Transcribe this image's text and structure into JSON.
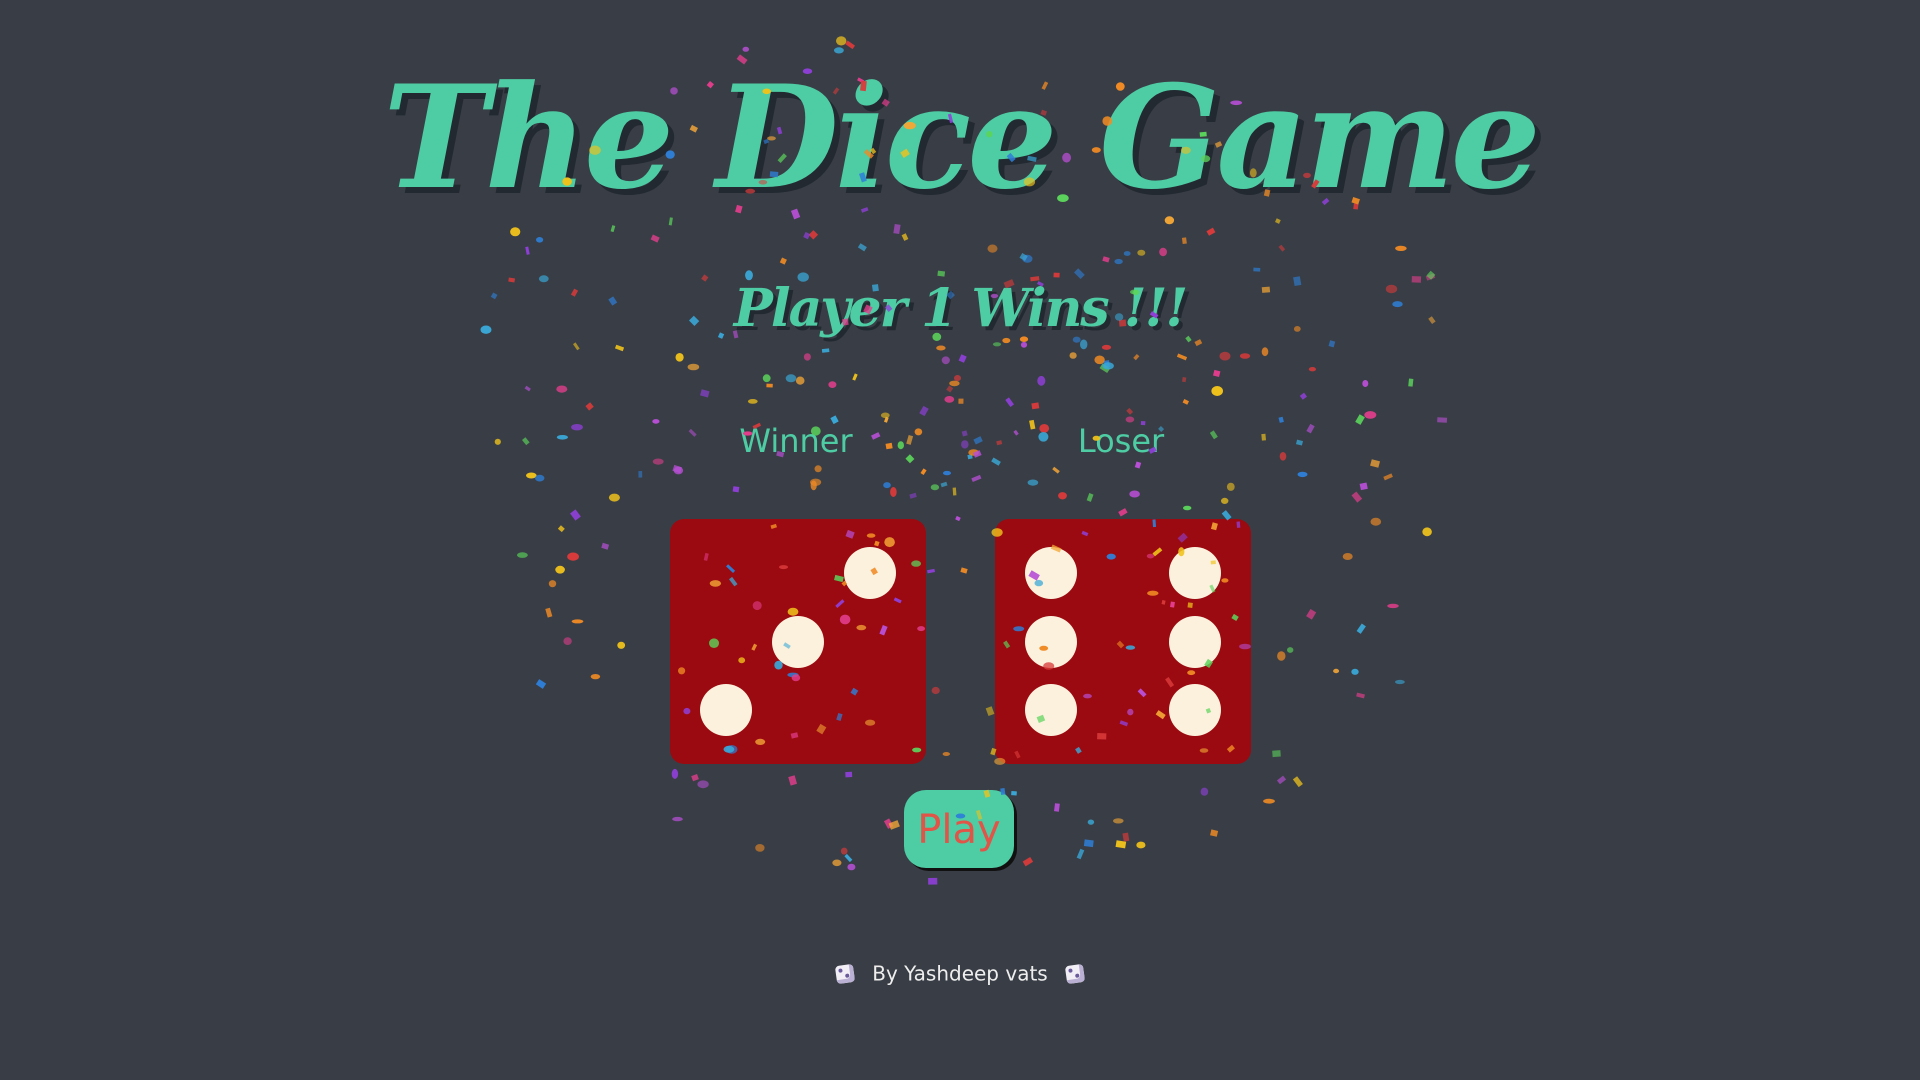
{
  "game": {
    "title": "The Dice Game",
    "result_message": "Player 1 Wins !!!"
  },
  "players": [
    {
      "role_label": "Winner",
      "die_value": 3
    },
    {
      "role_label": "Loser",
      "die_value": 6
    }
  ],
  "controls": {
    "play_label": "Play"
  },
  "footer": {
    "credit": "By Yashdeep vats",
    "icon": "dice-icon"
  },
  "colors": {
    "background": "#393E46",
    "accent": "#4ECCA3",
    "die_face": "#9B0A10",
    "pip": "#FBF1DD",
    "play_text": "#E05548"
  },
  "effects": {
    "confetti": true
  }
}
